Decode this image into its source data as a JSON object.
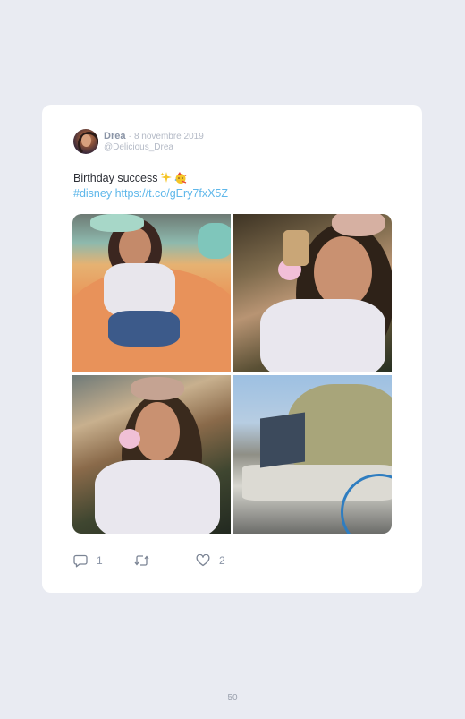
{
  "tweet": {
    "author_name": "Drea",
    "separator": "·",
    "date": "8 novembre 2019",
    "handle": "@Delicious_Drea",
    "text_line1": "Birthday success",
    "hashtag": "#disney",
    "link": "https://t.co/gEry7fxX5Z",
    "emojis": [
      "sparkles-emoji",
      "party-face-emoji"
    ],
    "photos": [
      {
        "name": "photo-teacup-ride"
      },
      {
        "name": "photo-ice-cream-smile"
      },
      {
        "name": "photo-ice-cream-tongue"
      },
      {
        "name": "photo-birthday-sign"
      }
    ]
  },
  "actions": {
    "reply_count": "1",
    "retweet_count": "",
    "like_count": "2",
    "icons": [
      "reply-icon",
      "retweet-icon",
      "heart-icon"
    ]
  },
  "page": {
    "number": "50"
  },
  "colors": {
    "background": "#e9ebf2",
    "card": "#ffffff",
    "link": "#5eb7ea",
    "muted": "#8a94a6"
  }
}
